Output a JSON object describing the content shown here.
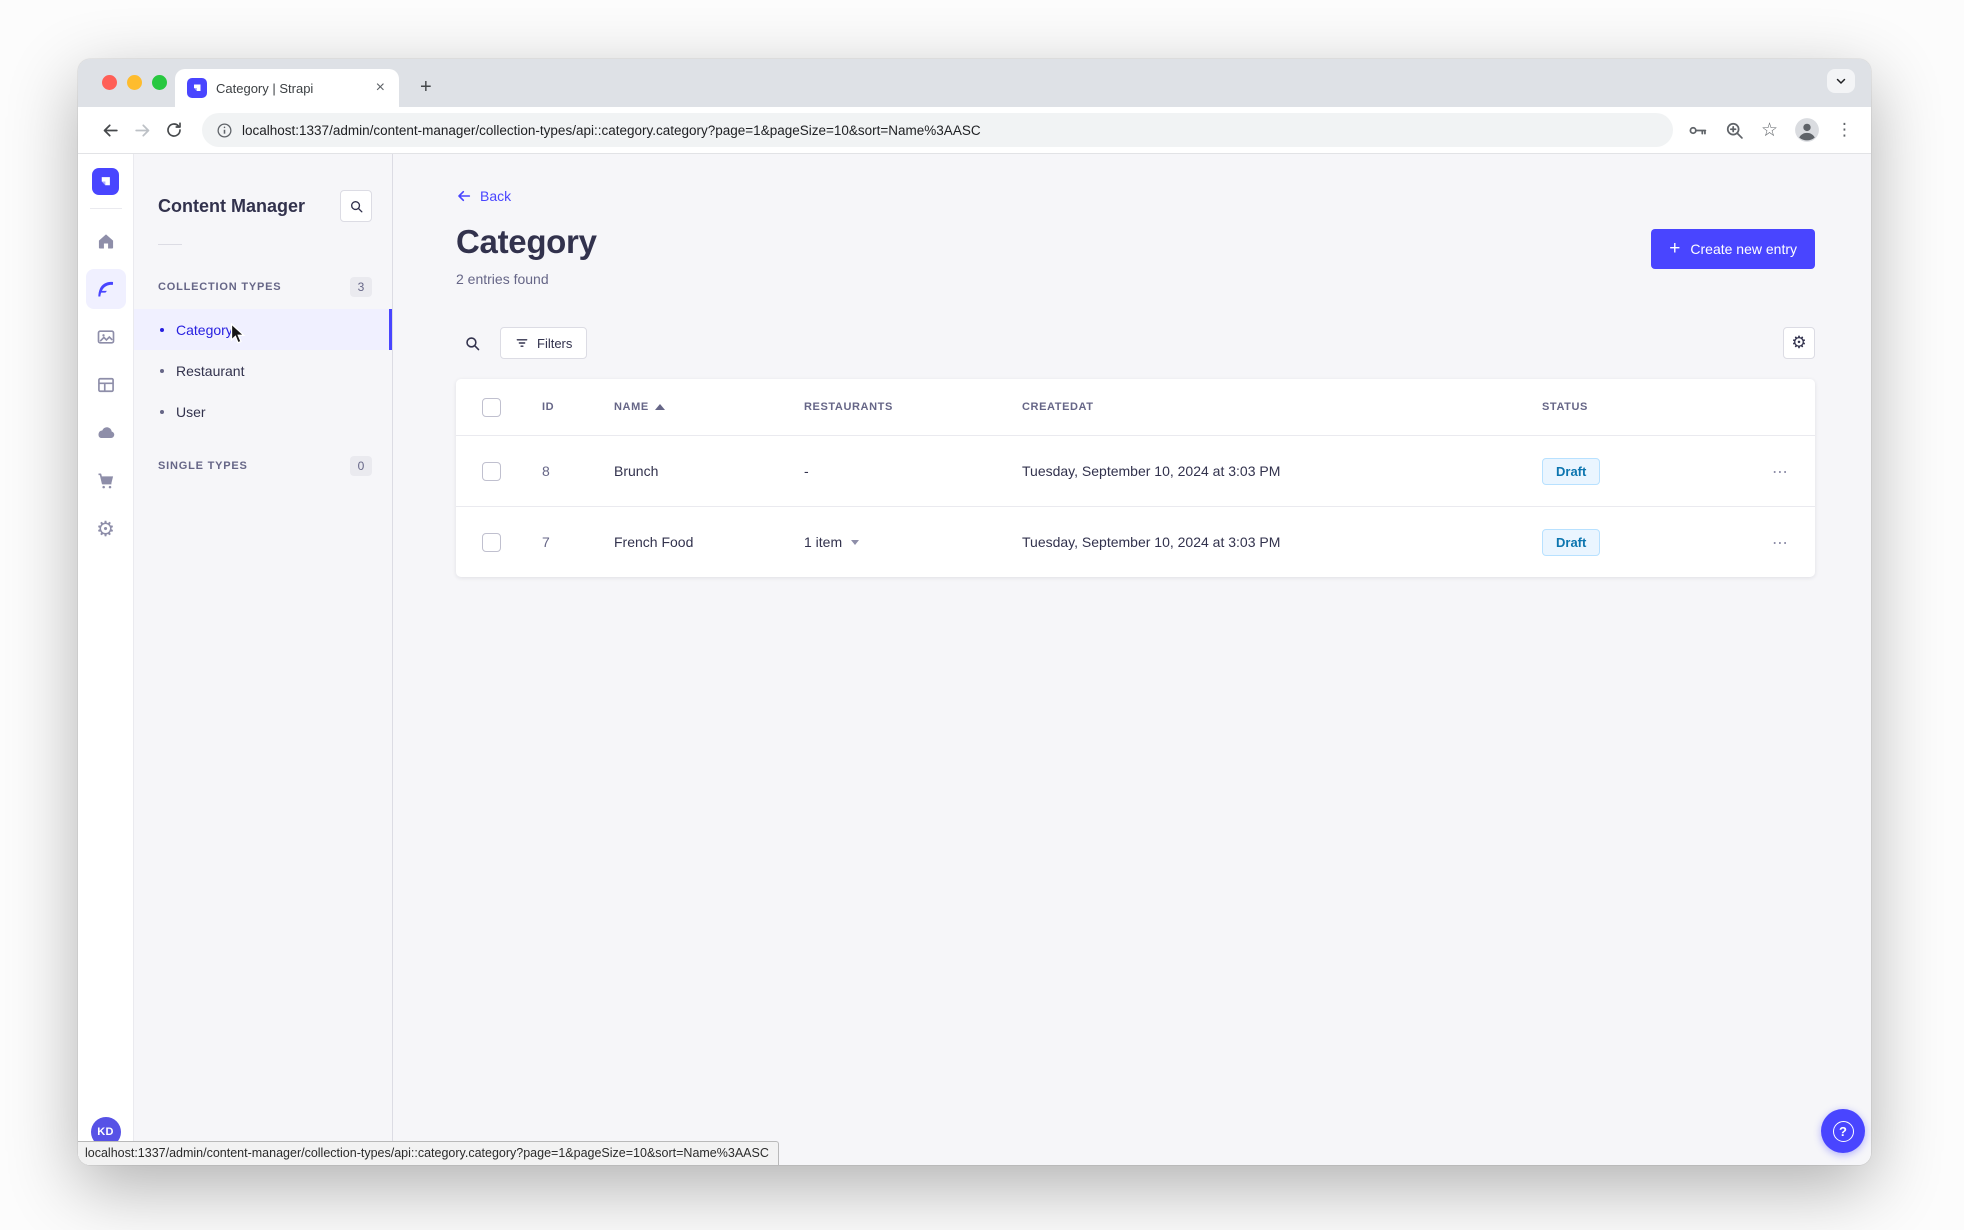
{
  "browser": {
    "tab_title": "Category | Strapi",
    "url": "localhost:1337/admin/content-manager/collection-types/api::category.category?page=1&pageSize=10&sort=Name%3AASC",
    "status_bar_url": "localhost:1337/admin/content-manager/collection-types/api::category.category?page=1&pageSize=10&sort=Name%3AASC"
  },
  "icons": {
    "close": "×",
    "plus": "+",
    "star": "☆",
    "dots_vertical": "⋮",
    "ellipsis": "⋯",
    "gear": "⚙",
    "question": "?"
  },
  "sidebar": {
    "avatar_initials": "KD"
  },
  "subnav": {
    "title": "Content Manager",
    "collection_types": {
      "label": "COLLECTION TYPES",
      "count": "3",
      "items": [
        {
          "label": "Category",
          "active": true
        },
        {
          "label": "Restaurant",
          "active": false
        },
        {
          "label": "User",
          "active": false
        }
      ]
    },
    "single_types": {
      "label": "SINGLE TYPES",
      "count": "0"
    }
  },
  "main": {
    "back_label": "Back",
    "title": "Category",
    "subtitle": "2 entries found",
    "create_button_label": "Create new entry",
    "filters_button_label": "Filters",
    "table": {
      "columns": [
        "ID",
        "NAME",
        "RESTAURANTS",
        "CREATEDAT",
        "STATUS"
      ],
      "rows": [
        {
          "id": "8",
          "name": "Brunch",
          "restaurants": "-",
          "restaurants_expandable": false,
          "createdAt": "Tuesday, September 10, 2024 at 3:03 PM",
          "status": "Draft"
        },
        {
          "id": "7",
          "name": "French Food",
          "restaurants": "1 item",
          "restaurants_expandable": true,
          "createdAt": "Tuesday, September 10, 2024 at 3:03 PM",
          "status": "Draft"
        }
      ]
    }
  },
  "colors": {
    "primary": "#4945FF",
    "primary_light_bg": "#F0F0FF",
    "active_text": "#271FE0",
    "draft_bg": "#EAF5FF",
    "draft_border": "#B8E1FF",
    "draft_text": "#0C75AF",
    "app_bg": "#F6F6F9"
  }
}
